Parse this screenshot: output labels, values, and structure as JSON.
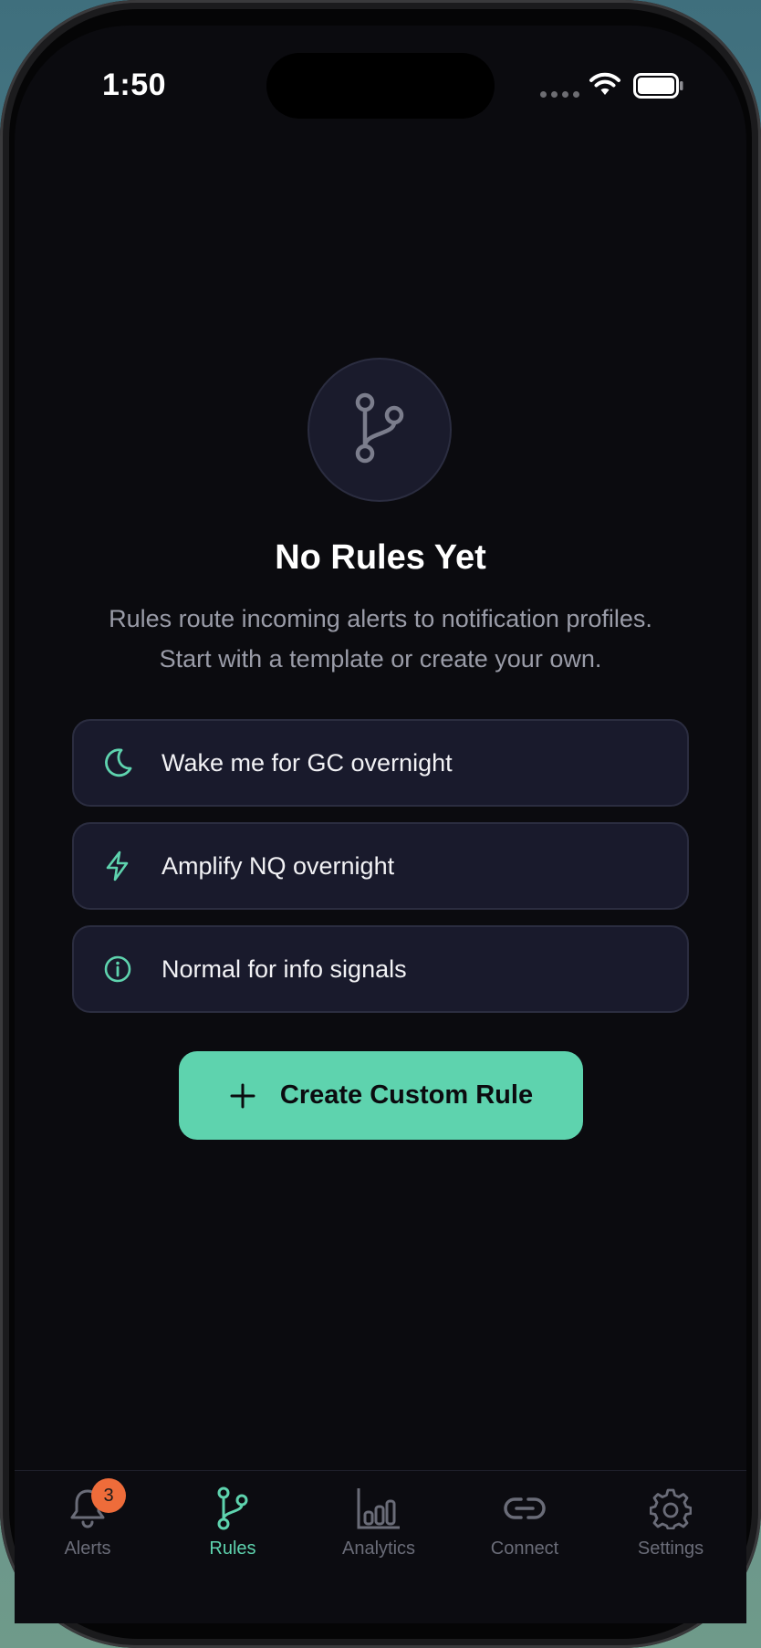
{
  "status_bar": {
    "time": "1:50"
  },
  "empty_state": {
    "icon": "git-branch-icon",
    "title": "No Rules Yet",
    "subtitle_line1": "Rules route incoming alerts to notification profiles.",
    "subtitle_line2": "Start with a template or create your own."
  },
  "templates": [
    {
      "icon": "moon-icon",
      "label": "Wake me for GC overnight"
    },
    {
      "icon": "lightning-icon",
      "label": "Amplify NQ overnight"
    },
    {
      "icon": "info-icon",
      "label": "Normal for info signals"
    }
  ],
  "create_button": {
    "icon": "plus-icon",
    "label": "Create Custom Rule"
  },
  "tab_bar": {
    "active": "Rules",
    "tabs": [
      {
        "icon": "bell-icon",
        "label": "Alerts",
        "badge": "3"
      },
      {
        "icon": "git-branch-icon",
        "label": "Rules"
      },
      {
        "icon": "bar-chart-icon",
        "label": "Analytics"
      },
      {
        "icon": "link-icon",
        "label": "Connect"
      },
      {
        "icon": "gear-icon",
        "label": "Settings"
      }
    ]
  },
  "colors": {
    "accent": "#5ed3ae",
    "background": "#0b0b0f",
    "card": "#191a2c",
    "badge": "#ee6c3a"
  }
}
